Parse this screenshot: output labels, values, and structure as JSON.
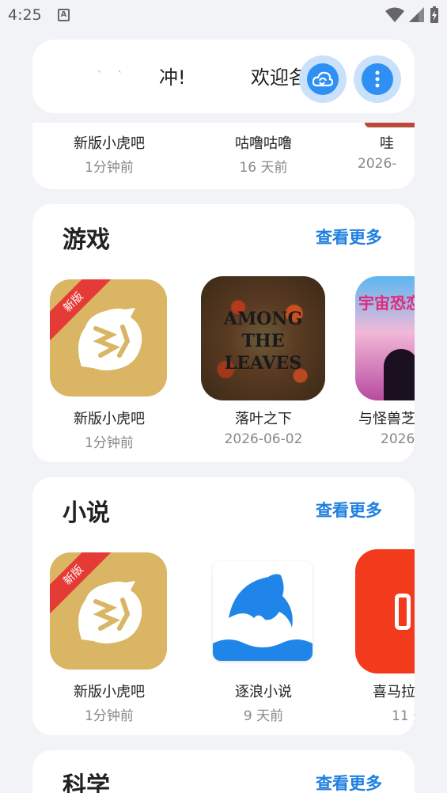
{
  "status_bar": {
    "time": "4:25",
    "sim_glyph": "A"
  },
  "header": {
    "marquee_text_1": "冲!",
    "marquee_text_2": "欢迎各位",
    "cloud_button": "cloud-sync-icon",
    "more_button": "more-vertical-icon"
  },
  "peek_row": {
    "items": [
      {
        "name": "新版小虎吧",
        "date": "1分钟前"
      },
      {
        "name": "咕噜咕噜",
        "date": "16 天前"
      },
      {
        "name": "哇",
        "date": "2026-"
      }
    ]
  },
  "games": {
    "title": "游戏",
    "more": "查看更多",
    "items": [
      {
        "name": "新版小虎吧",
        "date": "1分钟前",
        "badge": "新版"
      },
      {
        "name": "落叶之下",
        "date": "2026-06-02",
        "cover_text": "AMONG THE LEAVES"
      },
      {
        "name": "与怪兽芝",
        "date": "2026-",
        "cover_text": "宇宙恐恋"
      }
    ]
  },
  "novels": {
    "title": "小说",
    "more": "查看更多",
    "items": [
      {
        "name": "新版小虎吧",
        "date": "1分钟前",
        "badge": "新版"
      },
      {
        "name": "逐浪小说",
        "date": "9 天前"
      },
      {
        "name": "喜马拉",
        "date": "11 天"
      }
    ]
  },
  "science": {
    "title": "科学",
    "more": "查看更多"
  },
  "colors": {
    "accent": "#2e8ff5",
    "link": "#1f7fe0",
    "badge": "#e53b36",
    "tiger_bg": "#d9b564"
  }
}
